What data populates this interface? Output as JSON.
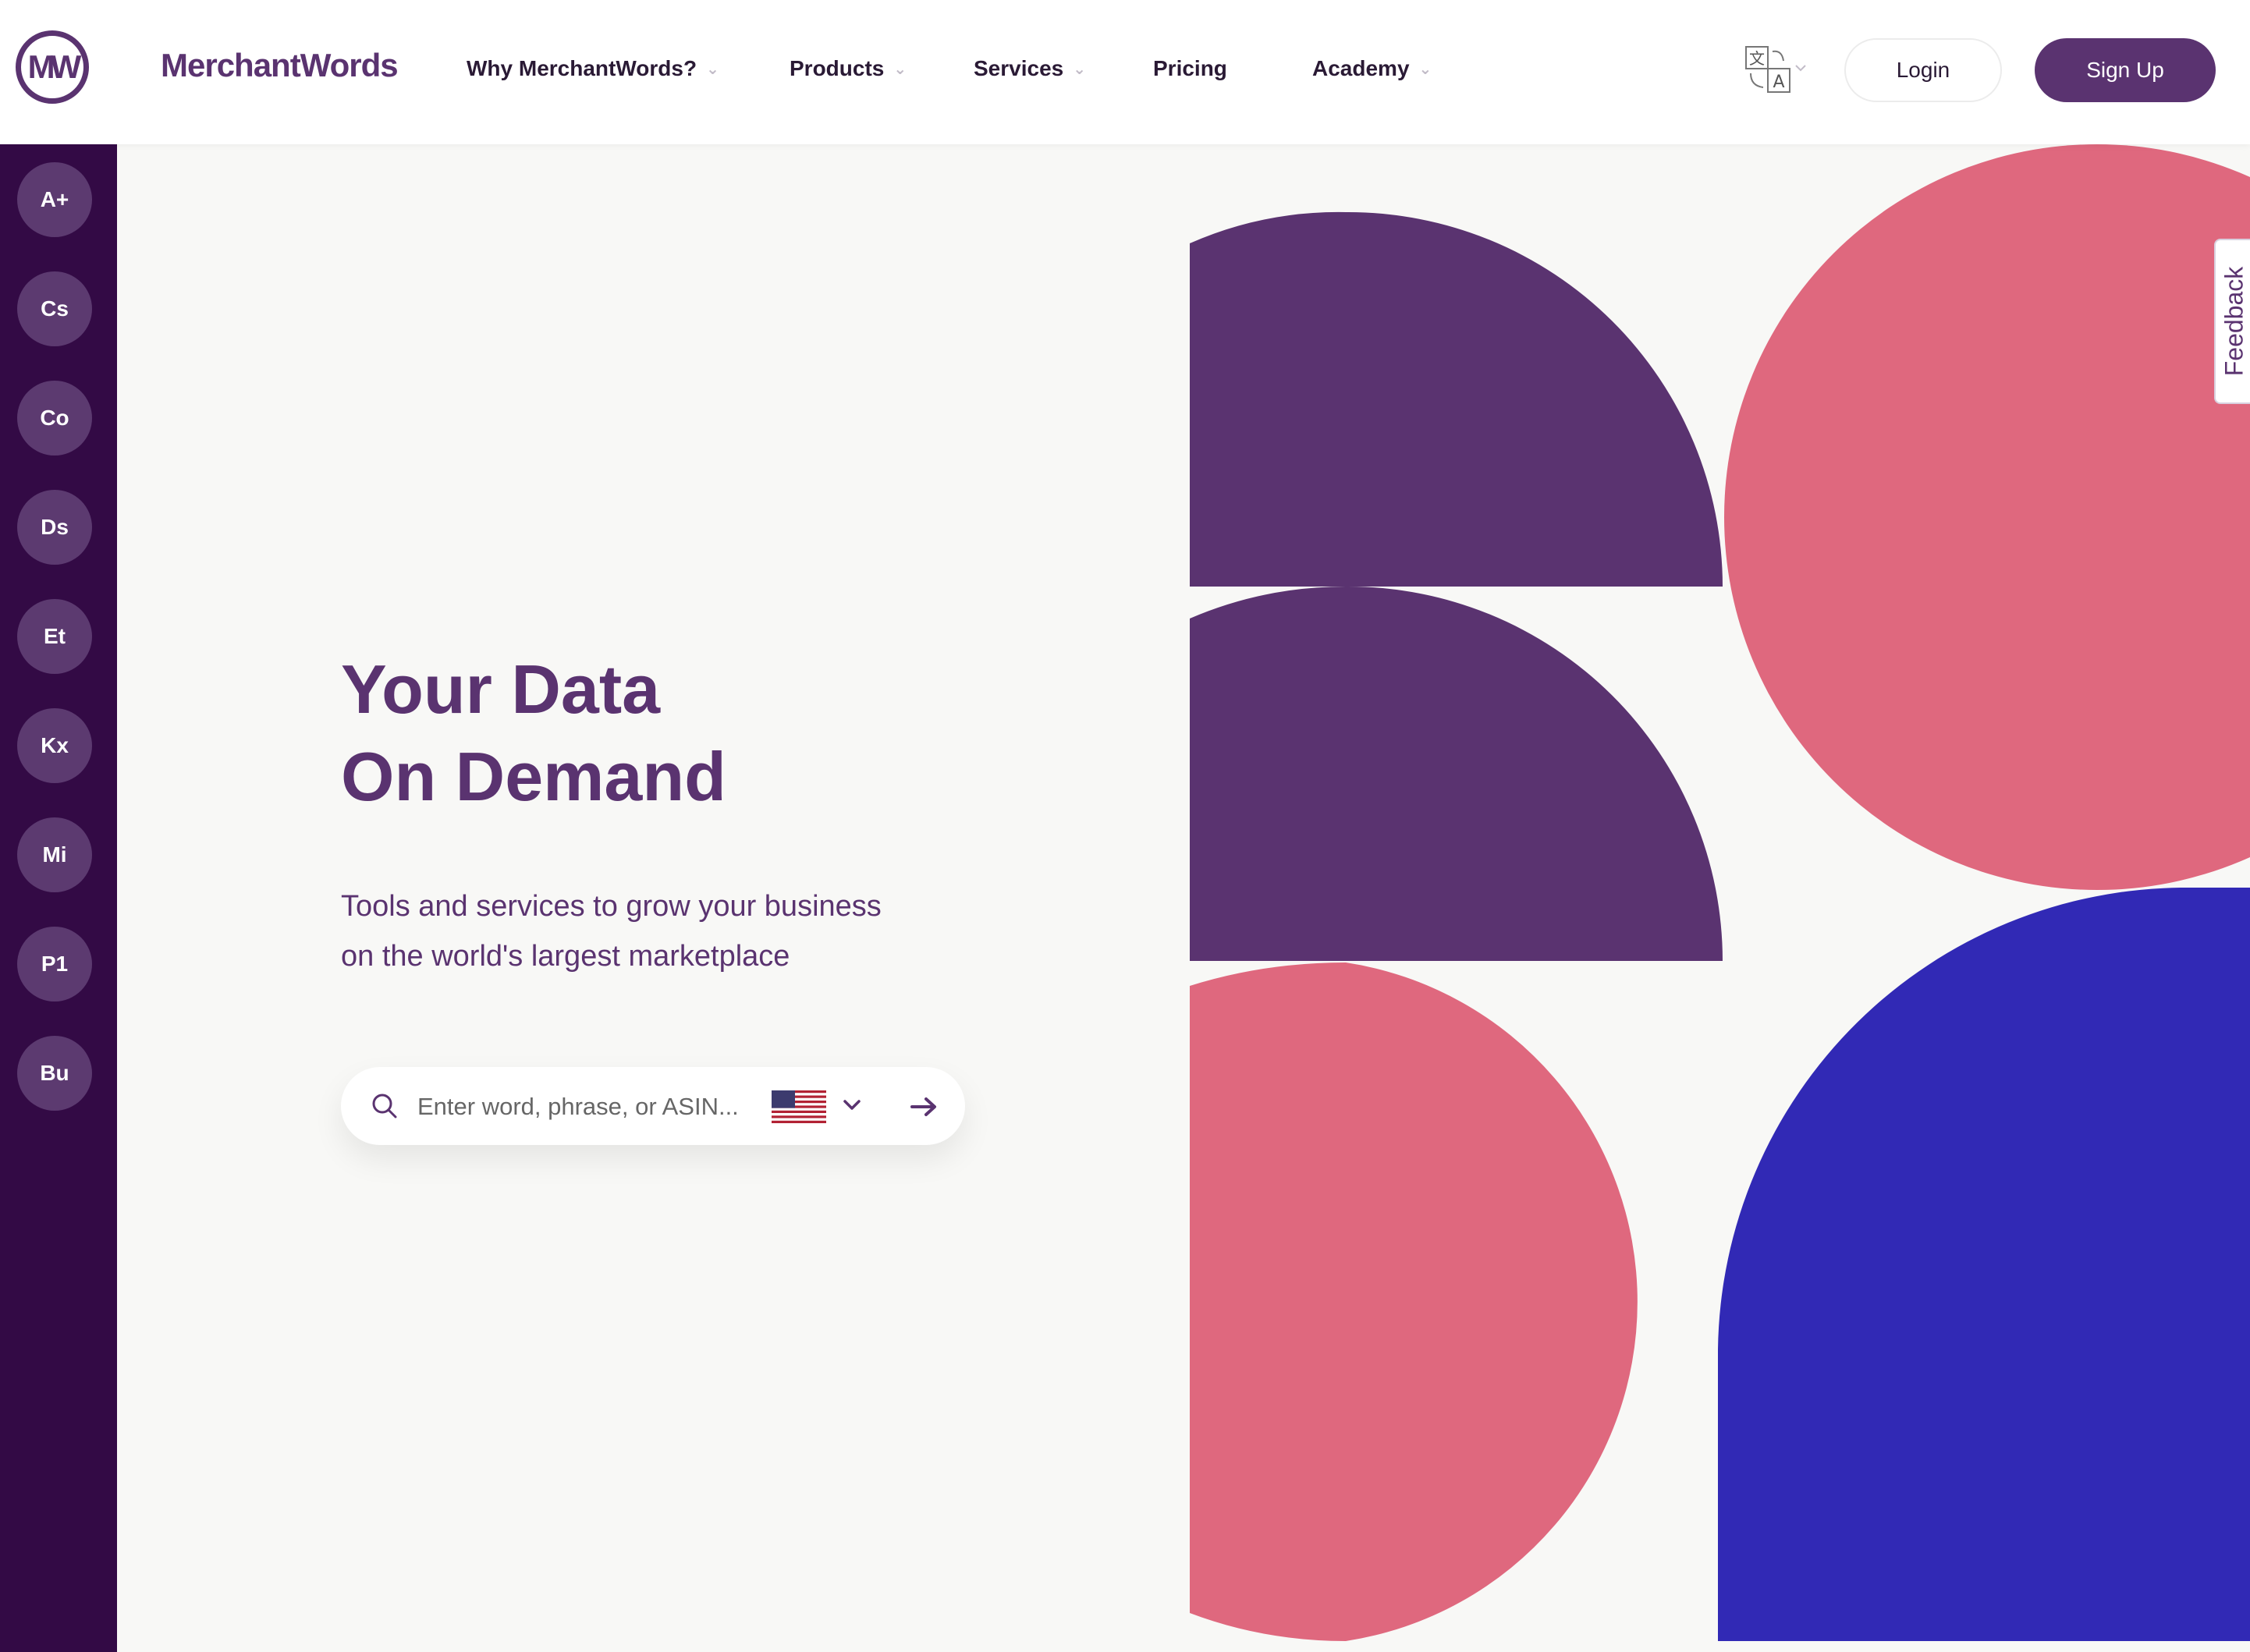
{
  "brand": {
    "logo_mark": "MW",
    "name": "MerchantWords"
  },
  "nav": {
    "items": [
      {
        "label": "Why MerchantWords?",
        "has_dropdown": true
      },
      {
        "label": "Products",
        "has_dropdown": true
      },
      {
        "label": "Services",
        "has_dropdown": true
      },
      {
        "label": "Pricing",
        "has_dropdown": false
      },
      {
        "label": "Academy",
        "has_dropdown": true
      }
    ],
    "language_icon": "translate-icon",
    "login_label": "Login",
    "signup_label": "Sign Up"
  },
  "sidebar": {
    "items": [
      {
        "label": "A+"
      },
      {
        "label": "Cs"
      },
      {
        "label": "Co"
      },
      {
        "label": "Ds"
      },
      {
        "label": "Et"
      },
      {
        "label": "Kx"
      },
      {
        "label": "Mi"
      },
      {
        "label": "P1"
      },
      {
        "label": "Bu"
      }
    ]
  },
  "hero": {
    "title_line1": "Your Data",
    "title_line2": "On Demand",
    "subtitle_line1": "Tools and services to grow your business",
    "subtitle_line2": "on the world's largest marketplace"
  },
  "search": {
    "placeholder": "Enter word, phrase, or ASIN...",
    "marketplace_flag": "us-flag-icon"
  },
  "feedback_label": "Feedback",
  "colors": {
    "brand_purple": "#5a3370",
    "sidebar_bg": "#330a45",
    "pink": "#df687e",
    "blue": "#3129b5"
  }
}
